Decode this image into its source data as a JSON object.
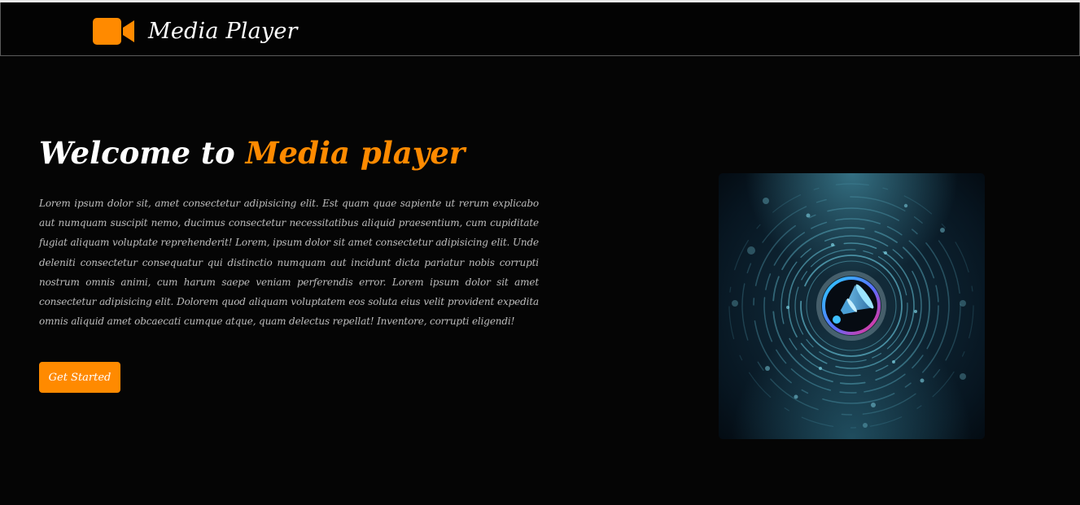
{
  "navbar": {
    "brand_name": "Media Player",
    "logo_icon": "video-camera-icon"
  },
  "hero": {
    "title_prefix": "Welcome to",
    "title_accent": "Media player",
    "description": "Lorem ipsum dolor sit, amet consectetur adipisicing elit. Est quam quae sapiente ut rerum explicabo aut numquam suscipit nemo, ducimus consectetur necessitatibus aliquid praesentium, cum cupiditate fugiat aliquam voluptate reprehenderit! Lorem, ipsum dolor sit amet consectetur adipisicing elit. Unde deleniti consectetur consequatur qui distinctio numquam aut incidunt dicta pariatur nobis corrupti nostrum omnis animi, cum harum saepe veniam perferendis error. Lorem ipsum dolor sit amet consectetur adipisicing elit. Dolorem quod aliquam voluptatem eos soluta eius velit provident expedita omnis aliquid amet obcaecati cumque atque, quam delectus repellat! Inventore, corrupti eligendi!",
    "cta_label": "Get Started",
    "art_icon": "speaker-swirl-illustration"
  },
  "colors": {
    "accent": "#ff8a00",
    "background": "#050505",
    "text": "#ffffff",
    "muted_text": "#bdbdbd"
  }
}
